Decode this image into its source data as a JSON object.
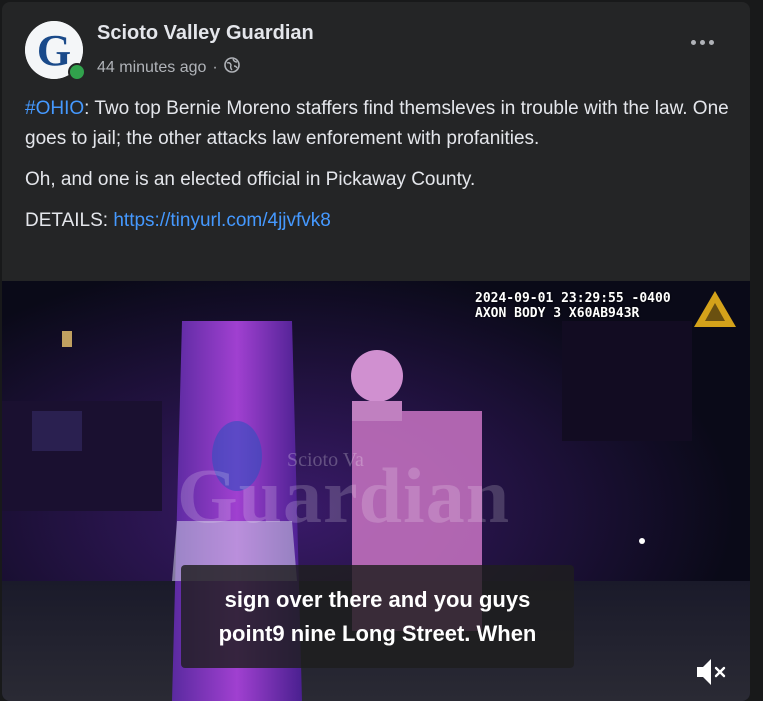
{
  "post": {
    "page_name": "Scioto Valley Guardian",
    "time_ago": "44 minutes ago",
    "separator": "·",
    "privacy_icon": "globe-icon",
    "more_icon": "more-options-icon",
    "hashtag": "#OHIO",
    "paragraph1_rest": ": Two top Bernie Moreno staffers find themsleves in trouble with the law. One goes to jail; the other attacks law enforement with profanities.",
    "paragraph2": "Oh, and one is an elected official in Pickaway County.",
    "details_label": "DETAILS: ",
    "details_link": "https://tinyurl.com/4jjvfvk8"
  },
  "video": {
    "timestamp_line1": "2024-09-01 23:29:55 -0400",
    "timestamp_line2": "AXON BODY 3 X60AB943R",
    "watermark_text": "Guardian",
    "watermark_small": "Scioto Va",
    "caption_line1": "sign over there and you guys",
    "caption_line2": "point9 nine Long Street. When",
    "mute_icon": "volume-muted-icon"
  },
  "colors": {
    "card_bg": "#242526",
    "link": "#4599ff",
    "online": "#31a24c"
  }
}
